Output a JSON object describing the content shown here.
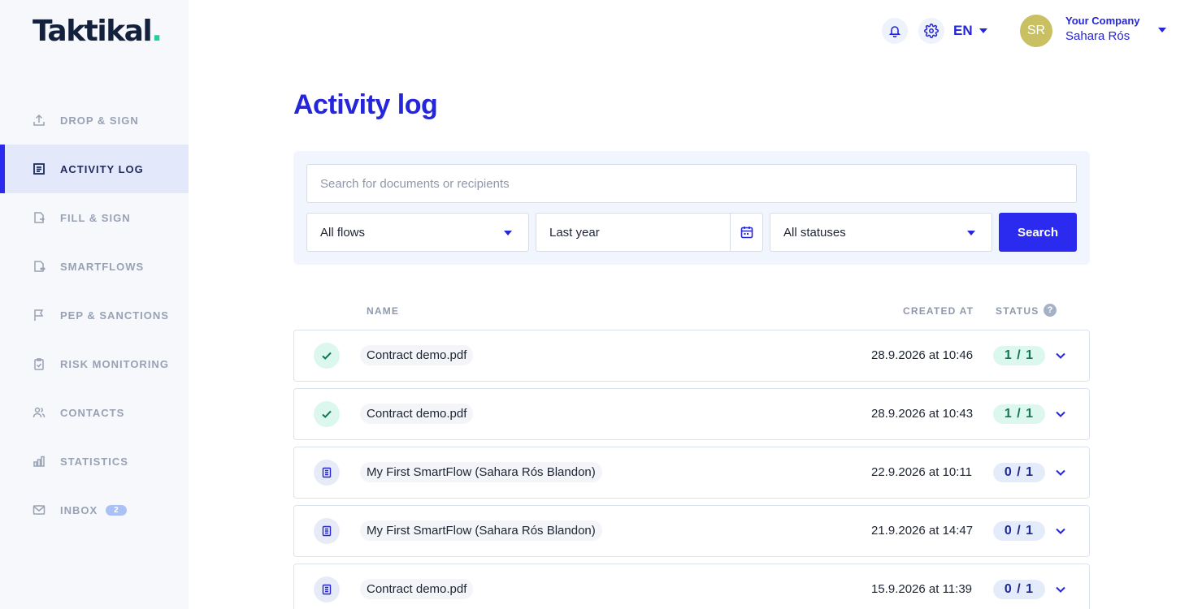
{
  "brand": {
    "name": "Taktikal",
    "dot": ".",
    "accent": "#1fd19a"
  },
  "colors": {
    "primary": "#2b2bf0",
    "sidebar_bg": "#f6f8fc",
    "success": "#1fd19a"
  },
  "sidebar": {
    "items": [
      {
        "label": "DROP & SIGN",
        "icon": "upload-icon",
        "active": false
      },
      {
        "label": "ACTIVITY LOG",
        "icon": "list-icon",
        "active": true
      },
      {
        "label": "FILL & SIGN",
        "icon": "form-icon",
        "active": false
      },
      {
        "label": "SMARTFLOWS",
        "icon": "flow-icon",
        "active": false
      },
      {
        "label": "PEP & SANCTIONS",
        "icon": "flag-icon",
        "active": false
      },
      {
        "label": "RISK MONITORING",
        "icon": "clipboard-check-icon",
        "active": false
      },
      {
        "label": "CONTACTS",
        "icon": "users-icon",
        "active": false
      },
      {
        "label": "STATISTICS",
        "icon": "bar-chart-icon",
        "active": false
      },
      {
        "label": "INBOX",
        "icon": "mail-icon",
        "active": false,
        "badge": "2"
      }
    ]
  },
  "header": {
    "language": "EN",
    "user": {
      "initials": "SR",
      "company": "Your Company",
      "name": "Sahara Rós"
    }
  },
  "page": {
    "title": "Activity log"
  },
  "filters": {
    "search_placeholder": "Search for documents or recipients",
    "flow": "All flows",
    "period": "Last year",
    "status": "All statuses",
    "search_label": "Search"
  },
  "table": {
    "columns": {
      "name": "NAME",
      "created": "CREATED AT",
      "status": "STATUS"
    },
    "help": "?",
    "rows": [
      {
        "name": "Contract demo.pdf",
        "created": "28.9.2026 at 10:46",
        "count": "1 / 1",
        "state": "done"
      },
      {
        "name": "Contract demo.pdf",
        "created": "28.9.2026 at 10:43",
        "count": "1 / 1",
        "state": "done"
      },
      {
        "name": "My First SmartFlow (Sahara Rós Blandon)",
        "created": "22.9.2026 at 10:11",
        "count": "0 / 1",
        "state": "pending"
      },
      {
        "name": "My First SmartFlow (Sahara Rós Blandon)",
        "created": "21.9.2026 at 14:47",
        "count": "0 / 1",
        "state": "pending"
      },
      {
        "name": "Contract demo.pdf",
        "created": "15.9.2026 at 11:39",
        "count": "0 / 1",
        "state": "pending"
      }
    ]
  }
}
